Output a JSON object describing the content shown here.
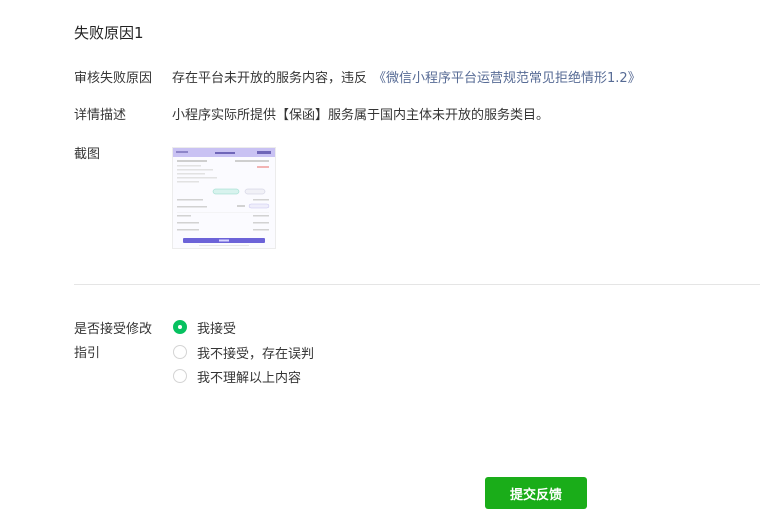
{
  "section_title": "失败原因1",
  "reason": {
    "label": "审核失败原因",
    "text": "存在平台未开放的服务内容，违反",
    "link": "《微信小程序平台运营规范常见拒绝情形1.2》"
  },
  "detail": {
    "label": "详情描述",
    "text": "小程序实际所提供【保函】服务属于国内主体未开放的服务类目。"
  },
  "screenshot": {
    "label": "截图"
  },
  "accept": {
    "label_line1": "是否接受修改",
    "label_line2": "指引",
    "options": [
      {
        "label": "我接受",
        "selected": true
      },
      {
        "label": "我不接受，存在误判",
        "selected": false
      },
      {
        "label": "我不理解以上内容",
        "selected": false
      }
    ]
  },
  "submit_label": "提交反馈",
  "colors": {
    "primary_green": "#1aad19",
    "radio_checked": "#07c160",
    "link": "#576b95"
  }
}
